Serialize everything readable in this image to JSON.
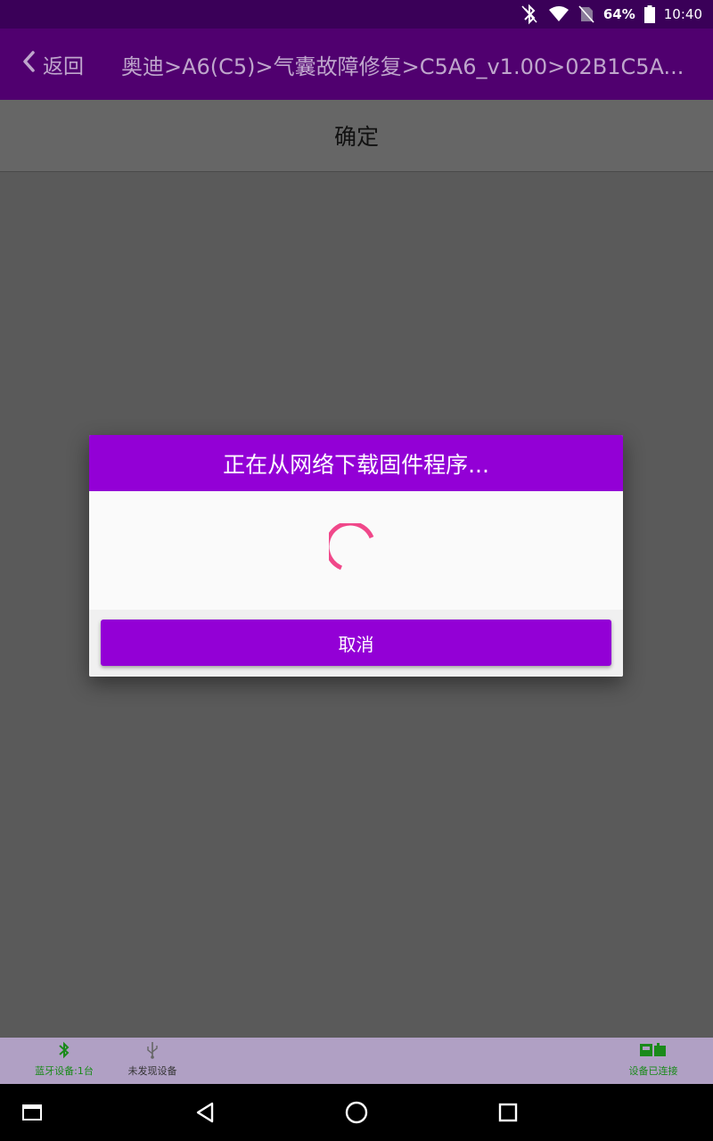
{
  "status_bar": {
    "battery_percent": "64%",
    "time": "10:40",
    "icons": [
      "bluetooth-off-icon",
      "wifi-icon",
      "sim-off-icon",
      "battery-icon"
    ]
  },
  "app_bar": {
    "back_label": "返回",
    "breadcrumb": "奥迪>A6(C5)>气囊故障修复>C5A6_v1.00>02B1C5A..."
  },
  "confirm_bar": {
    "label": "确定"
  },
  "dialog": {
    "title": "正在从网络下载固件程序...",
    "cancel_label": "取消",
    "spinner_color": "#f0488a"
  },
  "device_bar": {
    "bluetooth_label": "蓝牙设备:1台",
    "usb_label": "未发现设备",
    "connection_label": "设备已连接",
    "connected_color": "#1a8a1a"
  },
  "nav_bar": {
    "buttons": [
      "screenshot-icon",
      "back-icon",
      "home-icon",
      "recents-icon"
    ]
  }
}
